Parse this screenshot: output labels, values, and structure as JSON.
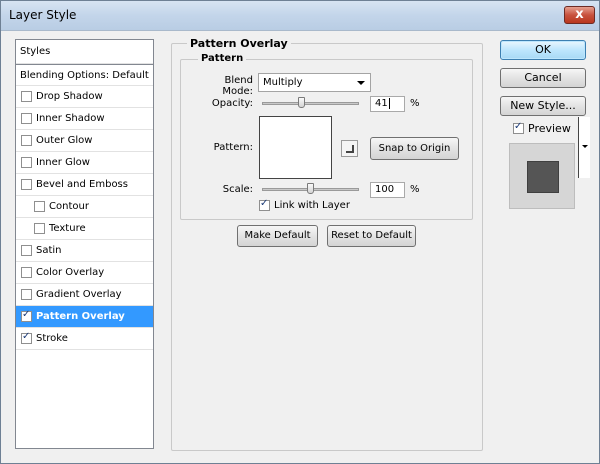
{
  "window": {
    "title": "Layer Style",
    "close_label": "x"
  },
  "styles": {
    "header": "Styles",
    "blending": "Blending Options: Default",
    "items": [
      {
        "label": "Drop Shadow",
        "checked": false,
        "indent": false,
        "selected": false
      },
      {
        "label": "Inner Shadow",
        "checked": false,
        "indent": false,
        "selected": false
      },
      {
        "label": "Outer Glow",
        "checked": false,
        "indent": false,
        "selected": false
      },
      {
        "label": "Inner Glow",
        "checked": false,
        "indent": false,
        "selected": false
      },
      {
        "label": "Bevel and Emboss",
        "checked": false,
        "indent": false,
        "selected": false
      },
      {
        "label": "Contour",
        "checked": false,
        "indent": true,
        "selected": false
      },
      {
        "label": "Texture",
        "checked": false,
        "indent": true,
        "selected": false
      },
      {
        "label": "Satin",
        "checked": false,
        "indent": false,
        "selected": false
      },
      {
        "label": "Color Overlay",
        "checked": false,
        "indent": false,
        "selected": false
      },
      {
        "label": "Gradient Overlay",
        "checked": false,
        "indent": false,
        "selected": false
      },
      {
        "label": "Pattern Overlay",
        "checked": true,
        "indent": false,
        "selected": true
      },
      {
        "label": "Stroke",
        "checked": true,
        "indent": false,
        "selected": false
      }
    ]
  },
  "overlay": {
    "title": "Pattern Overlay",
    "section": "Pattern",
    "blend_label": "Blend Mode:",
    "blend_value": "Multiply",
    "opacity_label": "Opacity:",
    "opacity_value": "41",
    "opacity_percent": 41,
    "opacity_unit": "%",
    "pattern_label": "Pattern:",
    "snap_label": "Snap to Origin",
    "scale_label": "Scale:",
    "scale_value": "100",
    "scale_percent": 100,
    "scale_unit": "%",
    "link_label": "Link with Layer",
    "link_checked": true,
    "make_default": "Make Default",
    "reset_default": "Reset to Default"
  },
  "actions": {
    "ok": "OK",
    "cancel": "Cancel",
    "new_style": "New Style...",
    "preview_label": "Preview",
    "preview_checked": true
  },
  "colors": {
    "selection": "#3399ff",
    "preview_swatch": "#555555"
  }
}
